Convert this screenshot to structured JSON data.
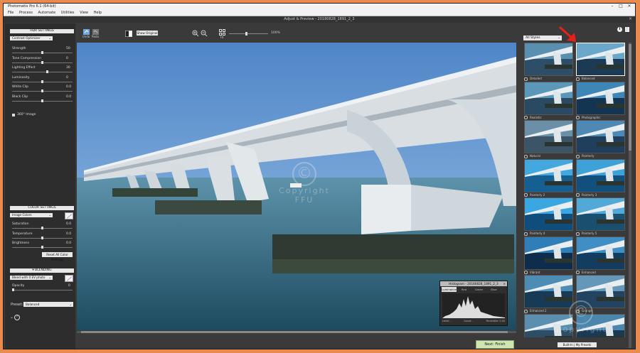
{
  "app": {
    "title": "Photomatix Pro 6.1 (64-bit)",
    "menu": [
      "File",
      "Process",
      "Automate",
      "Utilities",
      "View",
      "Help"
    ],
    "window_title": "Adjust & Preview - 20180828_1891_2_3"
  },
  "left_panel": {
    "hdr_header": "HDR SETTINGS",
    "method": "Contrast Optimizer",
    "hdr_sliders": [
      {
        "label": "Strength",
        "value": "50",
        "pos": 0.5
      },
      {
        "label": "Tone Compression",
        "value": "0",
        "pos": 0.5
      },
      {
        "label": "Lighting Effect",
        "value": "30",
        "pos": 0.58
      },
      {
        "label": "Luminosity",
        "value": "0",
        "pos": 0.5
      },
      {
        "label": "White Clip",
        "value": "0.0",
        "pos": 0.5
      },
      {
        "label": "Black Clip",
        "value": "0.0",
        "pos": 0.5
      }
    ],
    "option_360": "360° Image",
    "color_header": "COLOR SETTINGS",
    "image_colors": "Image Colors",
    "color_sliders": [
      {
        "label": "Saturation",
        "value": "0.0",
        "pos": 0.5
      },
      {
        "label": "Temperature",
        "value": "0.0",
        "pos": 0.5
      },
      {
        "label": "Brightness",
        "value": "0.0",
        "pos": 0.5
      }
    ],
    "reset_color": "Reset All Color Settings",
    "blending_header": "BLENDING",
    "blend_mode": "Blend with 0 EV photo",
    "opacity_label": "Opacity",
    "opacity_value": "0",
    "opacity_pos": 0.0,
    "preset_label": "Preset:",
    "preset_value": "Balanced",
    "help_icon": "help-icon",
    "arrow_icon": "chevron-down-icon"
  },
  "toolbar": {
    "undo": "Undo",
    "redo": "Redo",
    "show_original": "Show Original",
    "fit": "Fit",
    "zoom": "100%",
    "zoom_pos": 0.45
  },
  "histogram": {
    "title": "Histogram - 20180828_1891_2_3",
    "tabs": [
      "Luminance",
      "Red",
      "Green",
      "Blue"
    ],
    "stats": [
      "Level: -",
      "Count: -",
      "Percentile: 0.00"
    ]
  },
  "next_button": "Next: Finish",
  "right_panel": {
    "filter": "All Styles",
    "styles": [
      {
        "name": "Detailed",
        "selected": false
      },
      {
        "name": "Balanced",
        "selected": true
      },
      {
        "name": "Realistic",
        "selected": false
      },
      {
        "name": "Photographic",
        "selected": false
      },
      {
        "name": "Natural",
        "selected": false
      },
      {
        "name": "Painterly",
        "selected": false
      },
      {
        "name": "Painterly 2",
        "selected": false
      },
      {
        "name": "Painterly 3",
        "selected": false
      },
      {
        "name": "Painterly 4",
        "selected": false
      },
      {
        "name": "Painterly 5",
        "selected": false
      },
      {
        "name": "Vibrant",
        "selected": false
      },
      {
        "name": "Enhanced",
        "selected": false
      },
      {
        "name": "Enhanced 2",
        "selected": false
      },
      {
        "name": "Grunge",
        "selected": false
      },
      {
        "name": "",
        "selected": false
      },
      {
        "name": "",
        "selected": false
      }
    ],
    "bottom_button": "Built-In | My Presets"
  },
  "watermark": {
    "symbol": "©",
    "lines": [
      "Copyright",
      "FFU"
    ]
  },
  "colors": {
    "accent_next": "#cfe6b3",
    "frame": "#e98a4e",
    "arrow": "#e8201a"
  }
}
